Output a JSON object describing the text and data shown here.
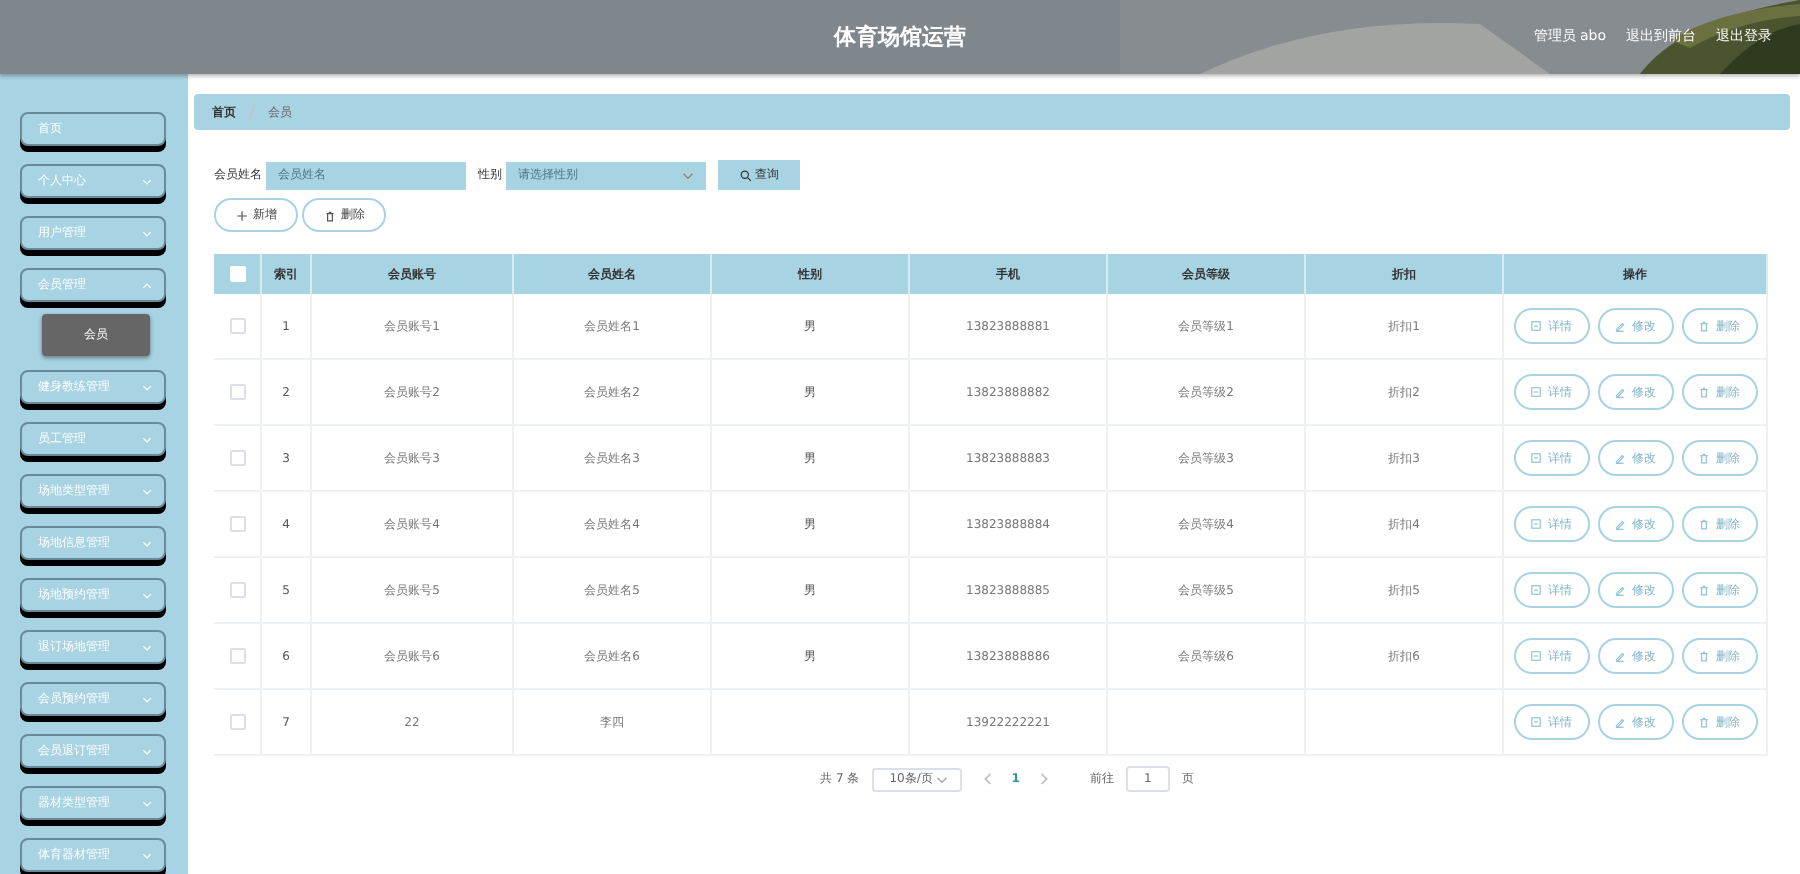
{
  "header": {
    "title": "体育场馆运营",
    "links": [
      "管理员 abo",
      "退出到前台",
      "退出登录"
    ]
  },
  "sidebar": {
    "items": [
      {
        "label": "首页",
        "expandable": false
      },
      {
        "label": "个人中心",
        "expandable": true,
        "expanded": false
      },
      {
        "label": "用户管理",
        "expandable": true,
        "expanded": false
      },
      {
        "label": "会员管理",
        "expandable": true,
        "expanded": true,
        "children": [
          {
            "label": "会员",
            "selected": true
          }
        ]
      },
      {
        "label": "健身教练管理",
        "expandable": true,
        "expanded": false
      },
      {
        "label": "员工管理",
        "expandable": true,
        "expanded": false
      },
      {
        "label": "场地类型管理",
        "expandable": true,
        "expanded": false
      },
      {
        "label": "场地信息管理",
        "expandable": true,
        "expanded": false
      },
      {
        "label": "场地预约管理",
        "expandable": true,
        "expanded": false
      },
      {
        "label": "退订场地管理",
        "expandable": true,
        "expanded": false
      },
      {
        "label": "会员预约管理",
        "expandable": true,
        "expanded": false
      },
      {
        "label": "会员退订管理",
        "expandable": true,
        "expanded": false
      },
      {
        "label": "器材类型管理",
        "expandable": true,
        "expanded": false
      },
      {
        "label": "体育器材管理",
        "expandable": true,
        "expanded": false
      }
    ]
  },
  "breadcrumb": [
    "首页",
    "会员"
  ],
  "search": {
    "fields": [
      {
        "label": "会员姓名",
        "placeholder": "会员姓名",
        "kind": "input"
      },
      {
        "label": "性别",
        "placeholder": "请选择性别",
        "kind": "select"
      }
    ],
    "button": "查询"
  },
  "actions": [
    "新增",
    "删除"
  ],
  "table": {
    "columns": [
      "索引",
      "会员账号",
      "会员姓名",
      "性别",
      "手机",
      "会员等级",
      "折扣",
      "操作"
    ],
    "all_checked": false,
    "rows": [
      {
        "checked": false,
        "cells": [
          "1",
          "会员账号1",
          "会员姓名1",
          "男",
          "13823888881",
          "会员等级1",
          "折扣1"
        ],
        "actions": [
          "详情",
          "修改",
          "删除"
        ]
      },
      {
        "checked": false,
        "cells": [
          "2",
          "会员账号2",
          "会员姓名2",
          "男",
          "13823888882",
          "会员等级2",
          "折扣2"
        ],
        "actions": [
          "详情",
          "修改",
          "删除"
        ]
      },
      {
        "checked": false,
        "cells": [
          "3",
          "会员账号3",
          "会员姓名3",
          "男",
          "13823888883",
          "会员等级3",
          "折扣3"
        ],
        "actions": [
          "详情",
          "修改",
          "删除"
        ]
      },
      {
        "checked": false,
        "cells": [
          "4",
          "会员账号4",
          "会员姓名4",
          "男",
          "13823888884",
          "会员等级4",
          "折扣4"
        ],
        "actions": [
          "详情",
          "修改",
          "删除"
        ]
      },
      {
        "checked": false,
        "cells": [
          "5",
          "会员账号5",
          "会员姓名5",
          "男",
          "13823888885",
          "会员等级5",
          "折扣5"
        ],
        "actions": [
          "详情",
          "修改",
          "删除"
        ]
      },
      {
        "checked": false,
        "cells": [
          "6",
          "会员账号6",
          "会员姓名6",
          "男",
          "13823888886",
          "会员等级6",
          "折扣6"
        ],
        "actions": [
          "详情",
          "修改",
          "删除"
        ]
      },
      {
        "checked": false,
        "cells": [
          "7",
          "22",
          "李四",
          "",
          "13922222221",
          "",
          ""
        ],
        "actions": [
          "详情",
          "修改",
          "删除"
        ]
      }
    ]
  },
  "pagination": {
    "total": "共 7 条",
    "page_size": "10条/页",
    "pages": [
      {
        "label": "1",
        "selected": true
      }
    ],
    "goto_label": "前往",
    "goto_value": "1",
    "goto_suffix": "页"
  }
}
